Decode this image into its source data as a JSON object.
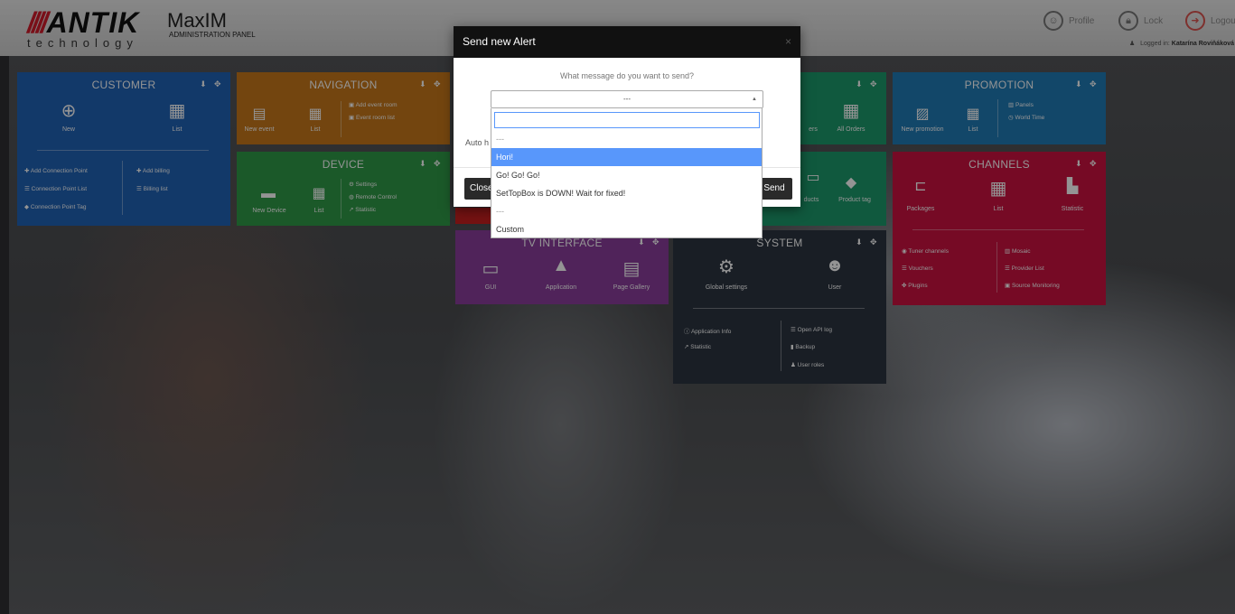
{
  "header": {
    "logo_stripes": "////",
    "logo_brand": "ANTIK",
    "logo_product": "MaxIM",
    "logo_subtitle": "ADMINISTRATION PANEL",
    "logo_tagline": "technology",
    "profile_label": "Profile",
    "lock_label": "Lock",
    "logout_label": "Logout",
    "logged_prefix": "Logged in:",
    "logged_user": "Katarína Roviňáková"
  },
  "tiles": {
    "customer": {
      "title": "CUSTOMER",
      "new_label": "New",
      "list_label": "List",
      "links": [
        "Add Connection Point",
        "Connection Point List",
        "Connection Point Tag",
        "Add billing",
        "Billing list"
      ],
      "color": "#1f62b6"
    },
    "navigation": {
      "title": "NAVIGATION",
      "new_event": "New event",
      "list_label": "List",
      "links": [
        "Add event room",
        "Event room list"
      ],
      "color": "#c6781a"
    },
    "device": {
      "title": "DEVICE",
      "new_device": "New Device",
      "list_label": "List",
      "links": [
        "Settings",
        "Remote Control",
        "Statistic"
      ],
      "color": "#2f9a47"
    },
    "orders": {
      "partial_label": "ers",
      "all_orders": "All Orders",
      "color": "#1d9a6c"
    },
    "products": {
      "partial_label": "ducts",
      "product_tag": "Product tag"
    },
    "promotion": {
      "title": "PROMOTION",
      "new_promotion": "New promotion",
      "list_label": "List",
      "links": [
        "Panels",
        "World Time"
      ],
      "color": "#1f7ab6"
    },
    "channels": {
      "title": "CHANNELS",
      "packages": "Packages",
      "list_label": "List",
      "statistic": "Statistic",
      "links": [
        "Tuner channels",
        "Vouchers",
        "Plugins",
        "Mosaic",
        "Provider List",
        "Source Monitoring"
      ],
      "color": "#cc1240"
    },
    "tv": {
      "title": "TV INTERFACE",
      "gui": "GUI",
      "application": "Application",
      "page_gallery": "Page Gallery",
      "color": "#8a3d9c"
    },
    "system": {
      "title": "SYSTEM",
      "global_settings": "Global settings",
      "user": "User",
      "links": [
        "Application Info",
        "Statistic",
        "Open API log",
        "Backup",
        "User roles"
      ],
      "color": "#2b3441"
    }
  },
  "modal": {
    "title": "Send new Alert",
    "close_x": "×",
    "question": "What message do you want to send?",
    "selected_value": "---",
    "auto_label": "Auto h",
    "close_button": "Close",
    "send_button": "Send"
  },
  "dropdown": {
    "search_value": "",
    "options": [
      "---",
      "Hori!",
      "Go! Go! Go!",
      "SetTopBox is DOWN! Wait for fixed!",
      "---",
      "Custom"
    ],
    "highlighted_index": 1
  }
}
